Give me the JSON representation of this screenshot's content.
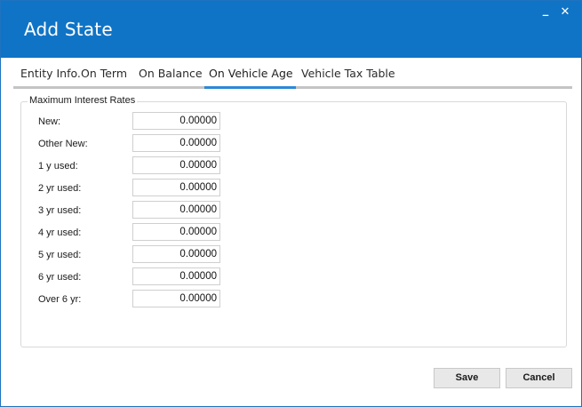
{
  "window": {
    "title": "Add State",
    "minimize_glyph": "_",
    "close_glyph": "✕"
  },
  "tabs": [
    {
      "label": "Entity Info.",
      "active": false
    },
    {
      "label": "On Term",
      "active": false
    },
    {
      "label": "On Balance",
      "active": false
    },
    {
      "label": "On Vehicle Age",
      "active": true
    },
    {
      "label": "Vehicle Tax Table",
      "active": false
    }
  ],
  "group": {
    "legend": "Maximum Interest Rates",
    "rows": [
      {
        "label": "New:",
        "value": "0.00000"
      },
      {
        "label": "Other New:",
        "value": "0.00000"
      },
      {
        "label": "1 y used:",
        "value": "0.00000"
      },
      {
        "label": "2 yr used:",
        "value": "0.00000"
      },
      {
        "label": "3 yr used:",
        "value": "0.00000"
      },
      {
        "label": "4 yr used:",
        "value": "0.00000"
      },
      {
        "label": "5 yr used:",
        "value": "0.00000"
      },
      {
        "label": "6 yr used:",
        "value": "0.00000"
      },
      {
        "label": "Over 6 yr:",
        "value": "0.00000"
      }
    ]
  },
  "buttons": {
    "save_label": "Save",
    "cancel_label": "Cancel"
  },
  "colors": {
    "titlebar": "#0f74c6",
    "active_tab_bar": "#2b88d8"
  }
}
